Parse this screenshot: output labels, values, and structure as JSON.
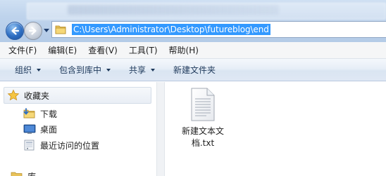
{
  "address": {
    "path": "C:\\Users\\Administrator\\Desktop\\futureblog\\end"
  },
  "icons": {
    "back": "arrow-left-icon",
    "forward": "arrow-right-icon",
    "address_folder": "folder-icon",
    "favorites": "star-icon",
    "downloads": "download-folder-icon",
    "desktop": "desktop-icon",
    "recent": "recent-places-icon",
    "file": "text-document-icon"
  },
  "menu": [
    {
      "label": "文件(F)"
    },
    {
      "label": "编辑(E)"
    },
    {
      "label": "查看(V)"
    },
    {
      "label": "工具(T)"
    },
    {
      "label": "帮助(H)"
    }
  ],
  "commands": [
    {
      "label": "组织",
      "dropdown": true
    },
    {
      "label": "包含到库中",
      "dropdown": true
    },
    {
      "label": "共享",
      "dropdown": true
    },
    {
      "label": "新建文件夹",
      "dropdown": false
    }
  ],
  "nav": {
    "favorites_label": "收藏夹",
    "items": [
      {
        "label": "下载"
      },
      {
        "label": "桌面"
      },
      {
        "label": "最近访问的位置"
      }
    ],
    "libraries_label": "库"
  },
  "files": [
    {
      "name_line1": "新建文本文",
      "name_line2": "档.txt"
    }
  ],
  "colors": {
    "selection": "#3399ff",
    "titlebar": "#bed3ec",
    "commandbar": "#dae5f2"
  }
}
